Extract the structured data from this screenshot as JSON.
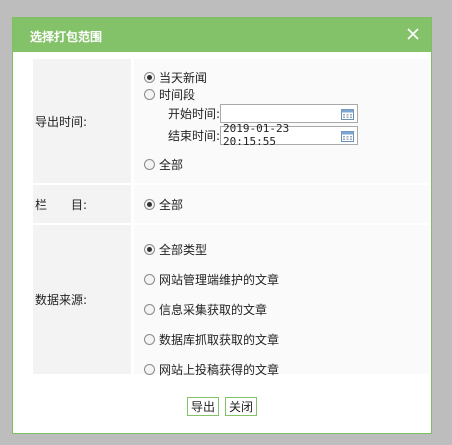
{
  "dialog": {
    "title": "选择打包范围",
    "close_icon": "close-icon",
    "colors": {
      "title_bar": "#84c26a",
      "border": "#7fbf64",
      "overlay": "#bdbdbd"
    }
  },
  "form": {
    "export_time": {
      "label": "导出时间:",
      "options": {
        "today": "当天新闻",
        "period": "时间段",
        "all": "全部"
      },
      "selected": "today",
      "start": {
        "label": "开始时间:",
        "value": "",
        "icon": "calendar-icon"
      },
      "end": {
        "label": "结束时间:",
        "value": "2019-01-23 20:15:55",
        "icon": "calendar-icon"
      }
    },
    "column": {
      "label": "栏　　目:",
      "options": {
        "all": "全部"
      },
      "selected": "all"
    },
    "source": {
      "label": "数据来源:",
      "options": {
        "all_types": "全部类型",
        "site_admin": "网站管理端维护的文章",
        "info_collect": "信息采集获取的文章",
        "db_fetch": "数据库抓取获取的文章",
        "site_submit": "网站上投稿获得的文章"
      },
      "selected": "all_types"
    }
  },
  "buttons": {
    "export": "导出",
    "close": "关闭"
  }
}
